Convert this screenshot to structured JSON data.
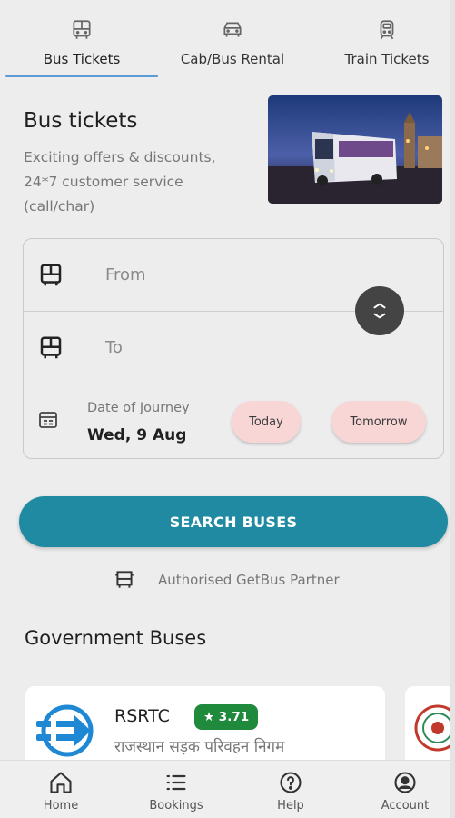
{
  "tabs": [
    {
      "label": "Bus Tickets",
      "icon": "bus-icon",
      "active": true
    },
    {
      "label": "Cab/Bus Rental",
      "icon": "car-icon",
      "active": false
    },
    {
      "label": "Train Tickets",
      "icon": "train-icon",
      "active": false
    }
  ],
  "header": {
    "title": "Bus tickets",
    "subtitle": "Exciting offers & discounts, 24*7 customer service (call/char)"
  },
  "form": {
    "from_placeholder": "From",
    "to_placeholder": "To",
    "date_label": "Date of Journey",
    "date_value": "Wed, 9 Aug",
    "today_label": "Today",
    "tomorrow_label": "Tomorrow"
  },
  "search_button_label": "SEARCH BUSES",
  "partner_text": "Authorised GetBus Partner",
  "government": {
    "title": "Government Buses",
    "cards": [
      {
        "name": "RSRTC",
        "rating": "★ 3.71",
        "subtitle": "राजस्थान सड़क परिवहन निगम"
      }
    ]
  },
  "bottom_nav": [
    {
      "label": "Home",
      "icon": "home-icon"
    },
    {
      "label": "Bookings",
      "icon": "list-icon"
    },
    {
      "label": "Help",
      "icon": "help-icon"
    },
    {
      "label": "Account",
      "icon": "account-icon"
    }
  ],
  "colors": {
    "accent": "#1f8aa1",
    "tab_underline": "#5b9bd5",
    "pill_bg": "#f8d6d6",
    "rating_bg": "#1f8a3c"
  }
}
